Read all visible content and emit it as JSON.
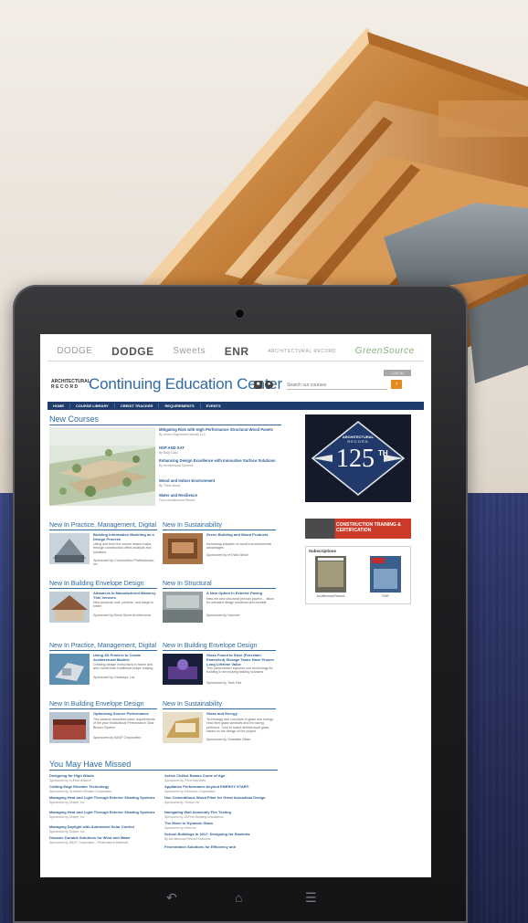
{
  "background": {
    "top_color": "#ede7df",
    "bottom_color": "#2e376a",
    "wood_color": "#c7833c"
  },
  "site": {
    "brands": [
      "DODGE",
      "DODGE",
      "Sweets",
      "ENR",
      "ARCHITECTURAL RECORD",
      "GreenSource"
    ],
    "logo_line1": "ARCHITECTURAL",
    "logo_line2": "RECORD",
    "title": "Continuing Education Center",
    "signin": "LOG IN",
    "search_placeholder": "Search our courses",
    "menu": [
      "HOME",
      "COURSE LIBRARY",
      "CREDIT TRACKER",
      "REQUIREMENTS",
      "EVENTS"
    ],
    "accent": "#2f6aa0",
    "menu_bg": "#1f3d6c",
    "search_btn_color": "#e48a1f"
  },
  "new_courses": {
    "heading": "New Courses",
    "items": [
      {
        "title": "Mitigating Risk with High Performance Structural Wood Panels",
        "by": "By Huber Engineered Woods LLC"
      },
      {
        "title": "HSP AND SAT",
        "by": "By Bally Labs"
      },
      {
        "title": "Enhancing Design Excellence with Innovative Surface Solutions",
        "by": "By Architectural Systems"
      },
      {
        "title": "Wood and Indoor Environment",
        "by": "By Think Wood"
      },
      {
        "title": "Water and Resilience",
        "by": "From Architectural Record"
      }
    ]
  },
  "sections": [
    {
      "heading": "New In Practice, Management, Digital",
      "title": "Building Information Modeling as a Design Process",
      "desc": "Using and from the course lesson maps through construction offers analysis and solutions",
      "by": "Sponsored by Construction Professionals, Inc."
    },
    {
      "heading": "New In Sustainability",
      "title": "Green Building and Wood Products",
      "desc": "Increasing adoption of wood's environmental advantages",
      "by": "Sponsored by reThink Wood"
    },
    {
      "heading": "New In Building Envelope Design",
      "title": "Advances in Manufactured Masonry Thin Veneers",
      "desc": "New products look, perform, and weigh in better",
      "by": "Sponsored by Boral Stone Architectural"
    },
    {
      "heading": "New In Structural",
      "title": "A New Option in Exterior Paving",
      "desc": "New rim and structural precast pavers ... allow for elevated design solutions and durable",
      "by": "Sponsored by Hanover"
    },
    {
      "heading": "New In Practice, Management, Digital",
      "title": "Using 3D Printers to Create Architectural Models",
      "desc": "Creating design instructions in faster and also model than traditional shape making",
      "by": "Sponsored by Stratasys, Ltd."
    },
    {
      "heading": "New In Building Envelope Design",
      "title": "Glass Fused to Steel (Porcelain Enameled) Storage Tanks Have Proven Long Lifetime Value",
      "desc": "This presentation explores one technology for building in developing tanking solutions",
      "by": "Sponsored by Tank Fab"
    },
    {
      "heading": "New In Building Envelope Design",
      "title": "Optimizing Source Performance",
      "desc": "This session describes basic requirements of the prior Institutional Performance Tank Blower System",
      "by": "Sponsored by BASF Corporation"
    },
    {
      "heading": "New In Sustainability",
      "title": "Glass and Energy",
      "desc": "Technology and concepts of glass and energy. How fiber glass windows and the facing performs - how to select architectural glass based on the design of the project",
      "by": "Sponsored by Guardian Glass"
    }
  ],
  "missed": {
    "heading": "You May Have Missed",
    "left": [
      {
        "title": "Designing for High Winds",
        "by": "Sponsored by In Brick Alliance"
      },
      {
        "title": "Cutting-Edge Elevator Technology",
        "by": "Sponsored by Schindler Elevator Corporation"
      },
      {
        "title": "Managing Heat and Light Through Exterior Shading Systems",
        "by": "Sponsored by Draper, Inc."
      },
      {
        "title": "Managing Heat and Light Through Exterior Shading Systems",
        "by": "Sponsored by Draper, Inc."
      },
      {
        "title": "Managing Daylight with Automated Solar Control",
        "by": "Sponsored by Draper, Inc."
      },
      {
        "title": "Disaster Durable Solutions for Wind and Water",
        "by": "Sponsored by BASF Corporation - Performance Materials"
      }
    ],
    "right": [
      {
        "title": "Active Chilled Beams Come of Age",
        "by": "Sponsored by Price Industries"
      },
      {
        "title": "Appliance Performance beyond ENERGY STAR®",
        "by": "Sponsored by Electrolux Corporation"
      },
      {
        "title": "Use Cementitious Wood Fiber for Great Acoustical Design",
        "by": "Sponsored by Tectum Inc."
      },
      {
        "title": "Navigating Wall Assembly Fire Testing",
        "by": "Sponsored by DuPont Building Innovations"
      },
      {
        "title": "The Move to Dynamic Glass",
        "by": "Sponsored by View Inc."
      },
      {
        "title": "School Buildings in 2017: Designing for Students",
        "by": "By Architectural Record Solutions"
      },
      {
        "title": "Fenestration Solutions for Efficiency and",
        "by": ""
      }
    ]
  },
  "sidebar": {
    "badge_line1": "ARCHITECTURAL",
    "badge_line2": "RECORD",
    "badge_number": "125",
    "badge_suffix": "TH",
    "promo": "CONSTRUCTION TRAINING & CERTIFICATION",
    "subscriptions_heading": "Subscriptions",
    "magazines": [
      "Architectural Record",
      "ENR"
    ]
  },
  "device": {
    "nav": [
      "↶",
      "⌂",
      "☰"
    ]
  }
}
